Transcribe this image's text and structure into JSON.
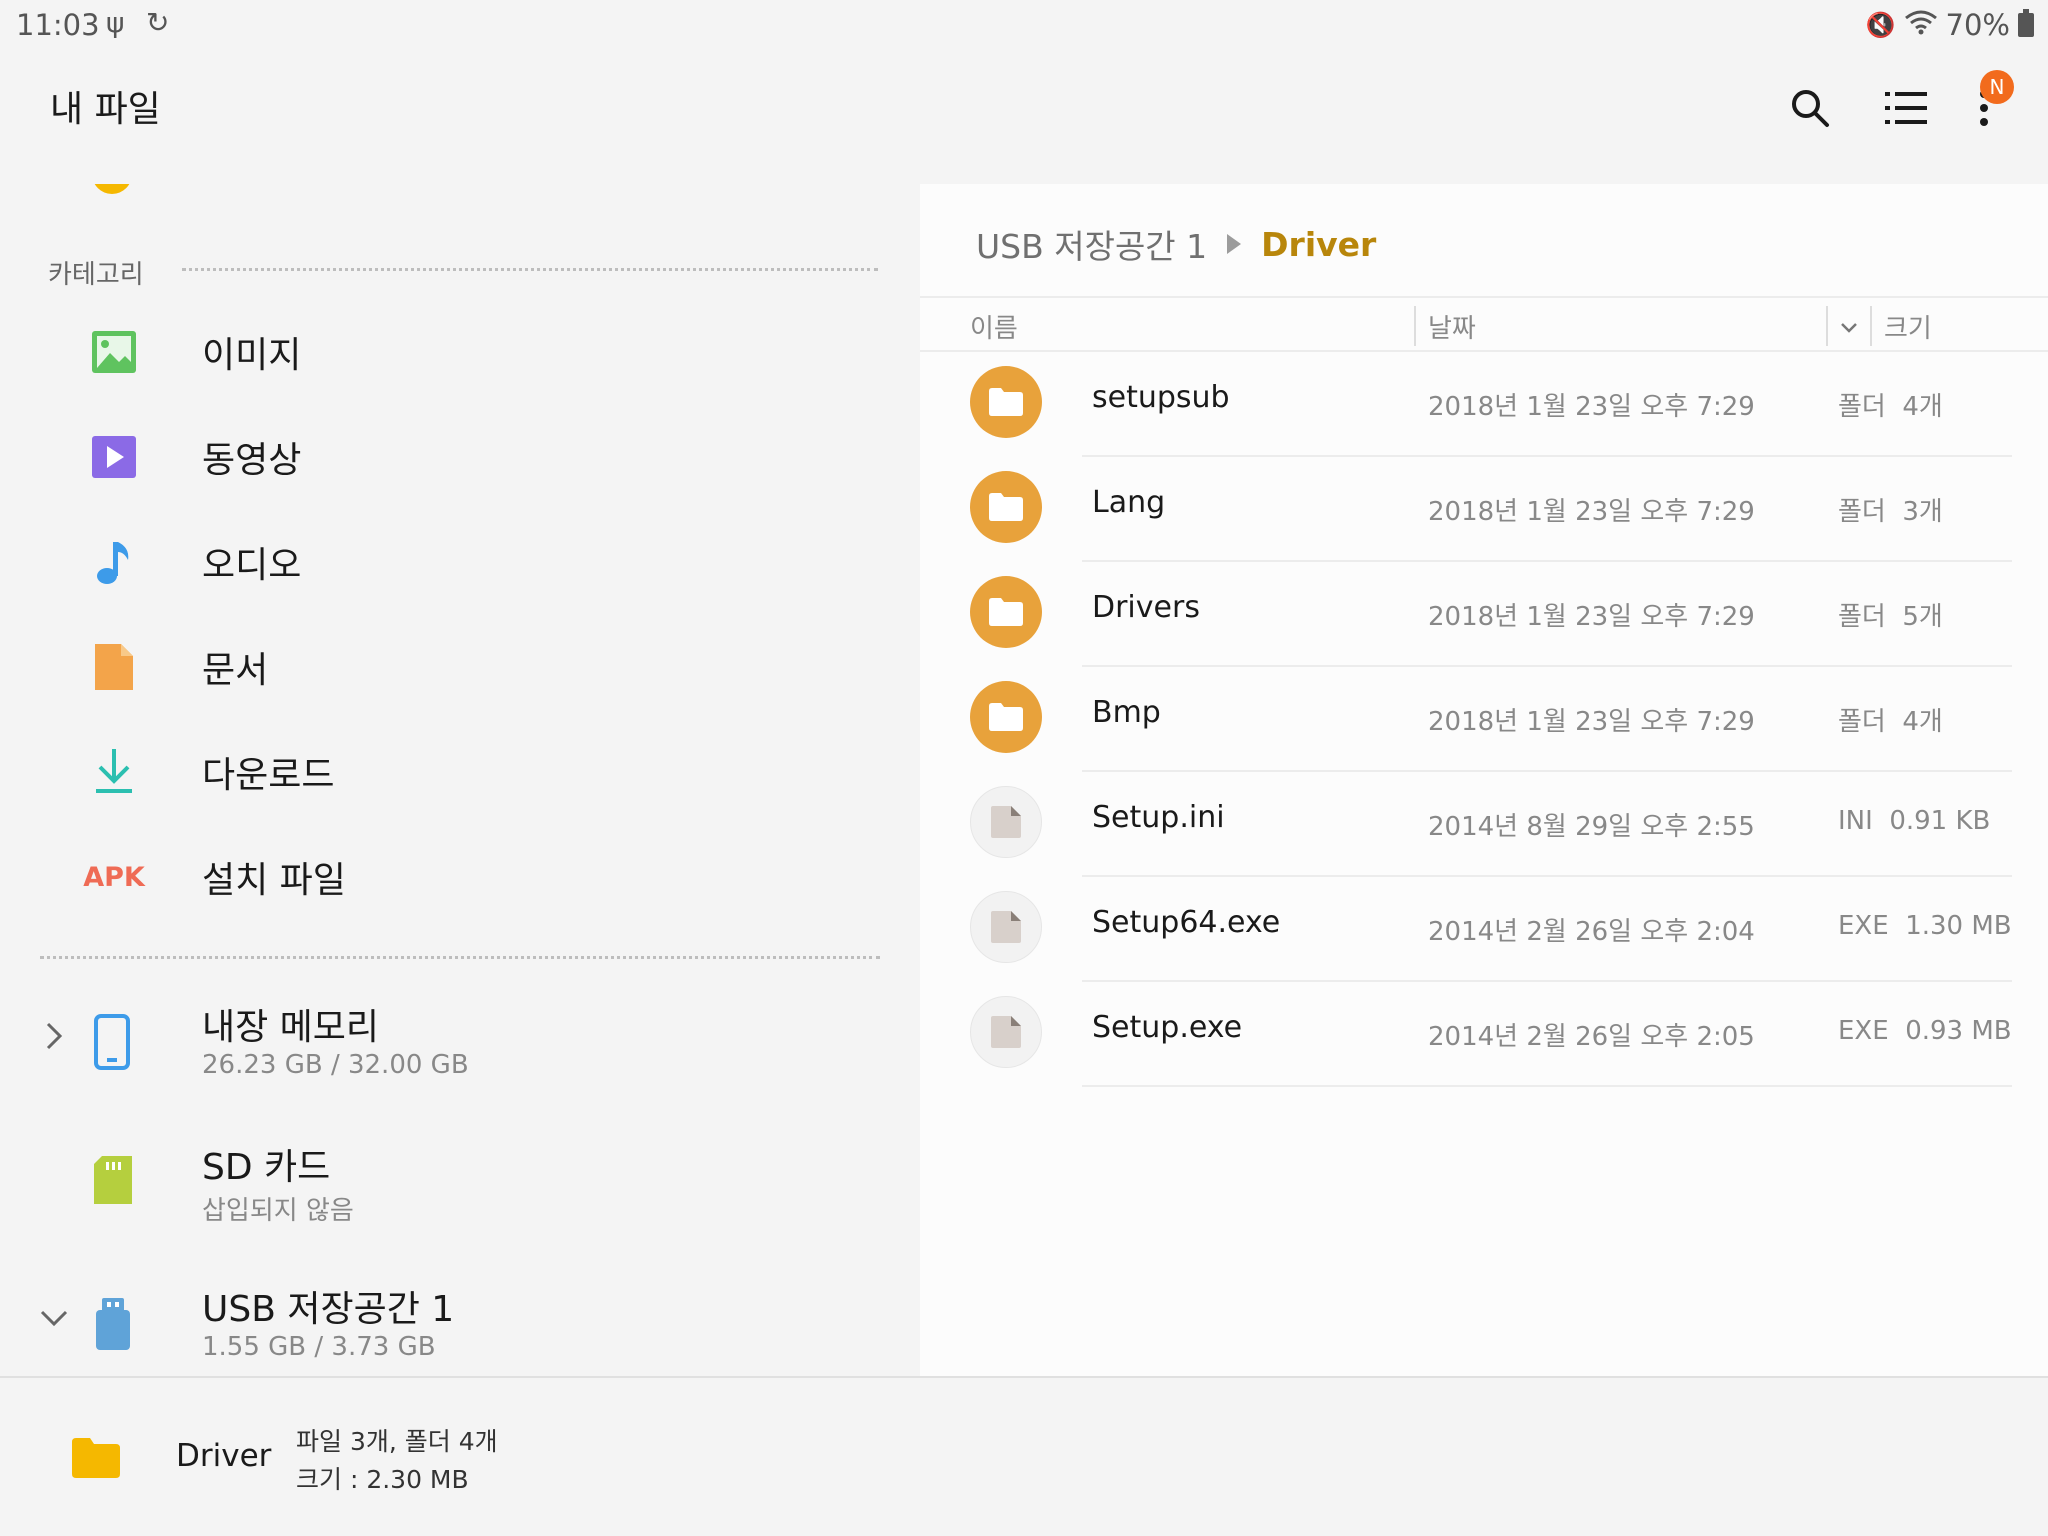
{
  "status_bar": {
    "time": "11:03",
    "battery": "70%",
    "icons": [
      "usb-icon",
      "sync-icon",
      "mute-icon",
      "wifi-icon",
      "battery-icon"
    ]
  },
  "app": {
    "title": "내 파일",
    "badge": "N",
    "actions": [
      "search-icon",
      "list-view-icon",
      "more-options-icon"
    ]
  },
  "sidebar": {
    "category_label": "카테고리",
    "categories": [
      {
        "label": "이미지",
        "icon": "image-icon",
        "color": "#5fc35f"
      },
      {
        "label": "동영상",
        "icon": "video-icon",
        "color": "#8b6ae6"
      },
      {
        "label": "오디오",
        "icon": "audio-icon",
        "color": "#3d9be9"
      },
      {
        "label": "문서",
        "icon": "document-icon",
        "color": "#f3a44a"
      },
      {
        "label": "다운로드",
        "icon": "download-icon",
        "color": "#2bbfb0"
      },
      {
        "label": "설치 파일",
        "icon": "apk-icon",
        "icon_text": "APK",
        "color": "#ef6b55"
      }
    ],
    "storage": [
      {
        "title": "내장 메모리",
        "sub": "26.23 GB / 32.00 GB",
        "icon": "phone-icon",
        "expand": "collapsed"
      },
      {
        "title": "SD 카드",
        "sub": "삽입되지 않음",
        "icon": "sd-card-icon",
        "expand": "none"
      },
      {
        "title": "USB 저장공간 1",
        "sub": "1.55 GB / 3.73 GB",
        "icon": "usb-drive-icon",
        "expand": "expanded"
      }
    ]
  },
  "breadcrumb": {
    "root": "USB 저장공간 1",
    "current": "Driver"
  },
  "columns": {
    "name": "이름",
    "date": "날짜",
    "size": "크기"
  },
  "files": [
    {
      "name": "setupsub",
      "date": "2018년 1월 23일 오후 7:29",
      "size": "폴더  4개",
      "type": "folder"
    },
    {
      "name": "Lang",
      "date": "2018년 1월 23일 오후 7:29",
      "size": "폴더  3개",
      "type": "folder"
    },
    {
      "name": "Drivers",
      "date": "2018년 1월 23일 오후 7:29",
      "size": "폴더  5개",
      "type": "folder"
    },
    {
      "name": "Bmp",
      "date": "2018년 1월 23일 오후 7:29",
      "size": "폴더  4개",
      "type": "folder"
    },
    {
      "name": "Setup.ini",
      "date": "2014년 8월 29일 오후 2:55",
      "size": "INI  0.91 KB",
      "type": "file"
    },
    {
      "name": "Setup64.exe",
      "date": "2014년 2월 26일 오후 2:04",
      "size": "EXE  1.30 MB",
      "type": "file"
    },
    {
      "name": "Setup.exe",
      "date": "2014년 2월 26일 오후 2:05",
      "size": "EXE  0.93 MB",
      "type": "file"
    }
  ],
  "bottom": {
    "folder_name": "Driver",
    "info_line1": "파일 3개, 폴더 4개",
    "info_line2": "크기 : 2.30 MB"
  },
  "colors": {
    "accent": "#b8860b",
    "folder": "#e8a23b",
    "badge": "#f26b1d"
  }
}
